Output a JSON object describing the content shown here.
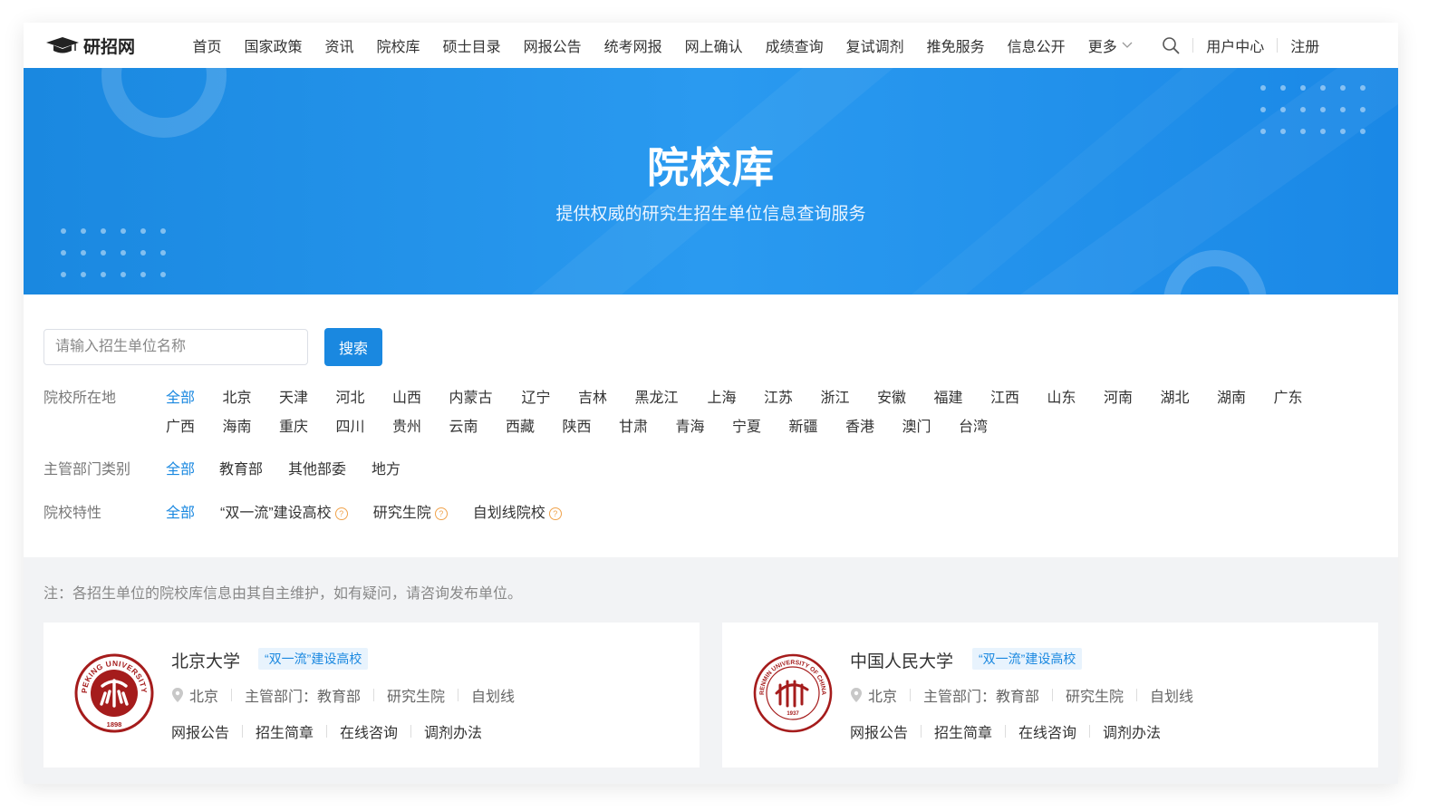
{
  "header": {
    "logo_text": "研招网",
    "nav": [
      "首页",
      "国家政策",
      "资讯",
      "院校库",
      "硕士目录",
      "网报公告",
      "统考网报",
      "网上确认",
      "成绩查询",
      "复试调剂",
      "推免服务",
      "信息公开"
    ],
    "more_label": "更多",
    "user_center": "用户中心",
    "register": "注册"
  },
  "banner": {
    "title": "院校库",
    "subtitle": "提供权威的研究生招生单位信息查询服务"
  },
  "search": {
    "placeholder": "请输入招生单位名称",
    "button": "搜索"
  },
  "filters": {
    "region": {
      "label": "院校所在地",
      "options": [
        "全部",
        "北京",
        "天津",
        "河北",
        "山西",
        "内蒙古",
        "辽宁",
        "吉林",
        "黑龙江",
        "上海",
        "江苏",
        "浙江",
        "安徽",
        "福建",
        "江西",
        "山东",
        "河南",
        "湖北",
        "湖南",
        "广东",
        "广西",
        "海南",
        "重庆",
        "四川",
        "贵州",
        "云南",
        "西藏",
        "陕西",
        "甘肃",
        "青海",
        "宁夏",
        "新疆",
        "香港",
        "澳门",
        "台湾"
      ]
    },
    "department": {
      "label": "主管部门类别",
      "options": [
        "全部",
        "教育部",
        "其他部委",
        "地方"
      ]
    },
    "feature": {
      "label": "院校特性",
      "options": [
        "全部",
        "“双一流”建设高校",
        "研究生院",
        "自划线院校"
      ]
    }
  },
  "note": "注：各招生单位的院校库信息由其自主维护，如有疑问，请咨询发布单位。",
  "universities": [
    {
      "name": "北京大学",
      "tag": "“双一流”建设高校",
      "location": "北京",
      "department": "主管部门：教育部",
      "feature1": "研究生院",
      "feature2": "自划线",
      "links": [
        "网报公告",
        "招生简章",
        "在线咨询",
        "调剂办法"
      ],
      "logo_text_top": "PEKING UNIVERSITY",
      "logo_year": "1898"
    },
    {
      "name": "中国人民大学",
      "tag": "“双一流”建设高校",
      "location": "北京",
      "department": "主管部门：教育部",
      "feature1": "研究生院",
      "feature2": "自划线",
      "links": [
        "网报公告",
        "招生简章",
        "在线咨询",
        "调剂办法"
      ],
      "logo_text_top": "RENMIN UNIVERSITY OF CHINA",
      "logo_year": "1937"
    }
  ],
  "colors": {
    "accent": "#1a88e0",
    "seal_red": "#a51c1c",
    "help_orange": "#f0a24b"
  }
}
